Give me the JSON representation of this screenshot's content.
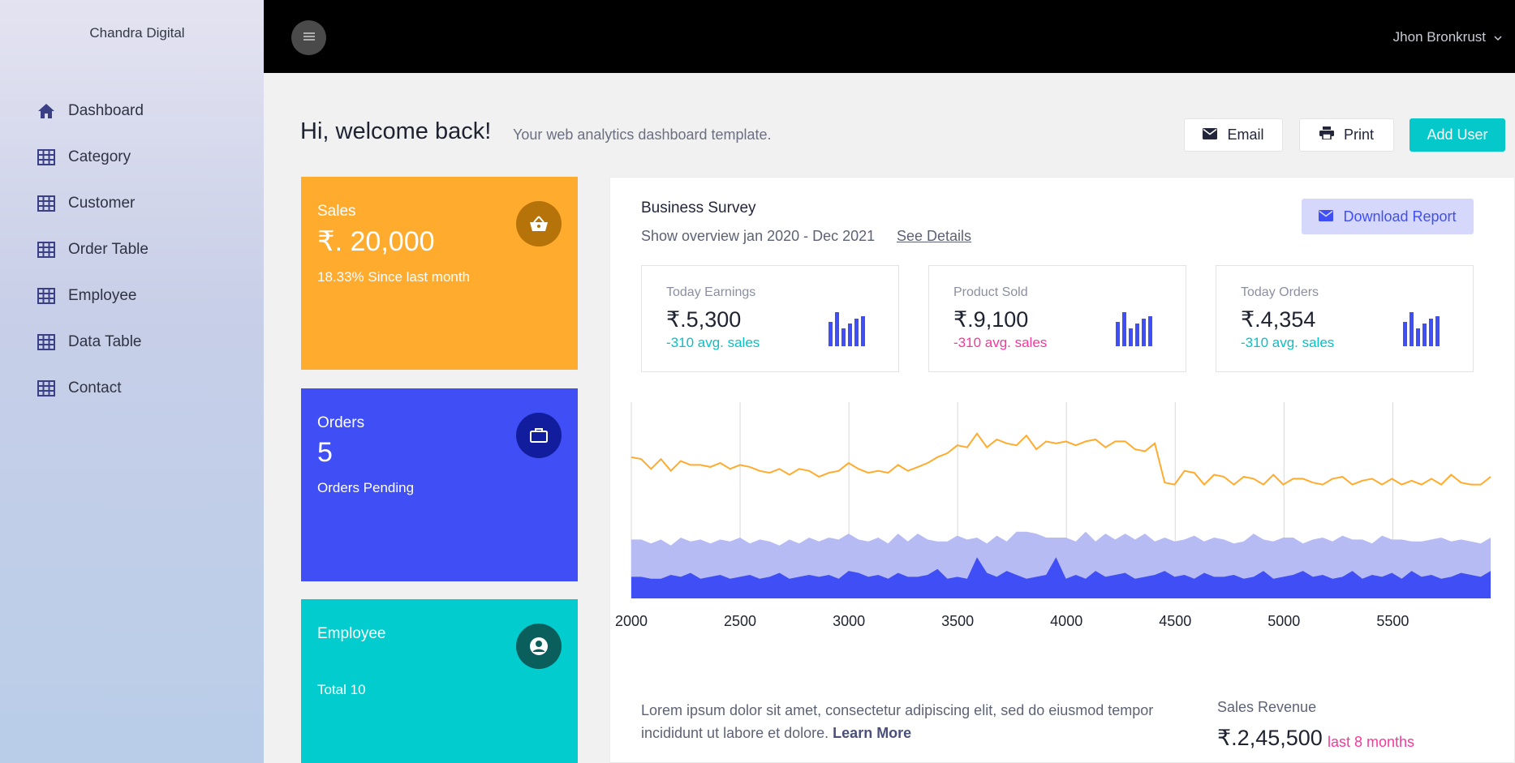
{
  "sidebar": {
    "brand": "Chandra Digital",
    "items": [
      {
        "label": "Dashboard",
        "icon": "home-icon"
      },
      {
        "label": "Category",
        "icon": "grid-icon"
      },
      {
        "label": "Customer",
        "icon": "grid-icon"
      },
      {
        "label": "Order Table",
        "icon": "grid-icon"
      },
      {
        "label": "Employee",
        "icon": "grid-icon"
      },
      {
        "label": "Data Table",
        "icon": "grid-icon"
      },
      {
        "label": "Contact",
        "icon": "grid-icon"
      }
    ]
  },
  "topbar": {
    "menu_icon": "hamburger-icon",
    "user_name": "Jhon Bronkrust"
  },
  "header": {
    "title": "Hi, welcome back!",
    "subtitle": "Your web analytics dashboard template.",
    "email_label": "Email",
    "print_label": "Print",
    "add_user_label": "Add User"
  },
  "cards": [
    {
      "title": "Sales",
      "value": "₹. 20,000",
      "sub": "18.33% Since last month",
      "color": "#ffab2e",
      "icon": "basket-icon"
    },
    {
      "title": "Orders",
      "value": "5",
      "sub": "Orders Pending",
      "color": "#3f4ef5",
      "icon": "briefcase-icon"
    },
    {
      "title": "Employee",
      "value": "",
      "sub": "Total 10",
      "color": "#02ccce",
      "icon": "user-circle-icon"
    }
  ],
  "survey": {
    "title": "Business Survey",
    "subtitle": "Show overview jan 2020 - Dec 2021",
    "link": "See Details",
    "download_label": "Download Report",
    "stats": [
      {
        "label": "Today Earnings",
        "value": "₹.5,300",
        "delta": "-310 avg. sales",
        "delta_color": "#07c1c6"
      },
      {
        "label": "Product Sold",
        "value": "₹.9,100",
        "delta": "-310 avg. sales",
        "delta_color": "#f7379a"
      },
      {
        "label": "Today Orders",
        "value": "₹.4,354",
        "delta": "-310 avg. sales",
        "delta_color": "#07c1c6"
      }
    ],
    "lorem_text": "Lorem ipsum dolor sit amet, consectetur adipiscing elit, sed do eiusmod tempor incididunt ut labore et dolore.",
    "learn_more": "Learn More",
    "revenue_label": "Sales Revenue",
    "revenue_value": "₹.2,45,500",
    "revenue_sub": "last 8 months"
  },
  "chart_data": {
    "type": "line",
    "x_ticks": [
      "2000",
      "2500",
      "3000",
      "3500",
      "4000",
      "4500",
      "5000",
      "5500"
    ],
    "x_range": [
      2000,
      5950
    ],
    "colors": {
      "line": "#ffab2e",
      "area_light": "#b6bbf3",
      "area_dark": "#3f4ef5"
    },
    "series": [
      {
        "type": "line",
        "values": [
          72,
          71,
          66,
          71,
          65,
          70,
          68,
          68,
          67,
          69,
          66,
          68,
          67,
          65,
          64,
          66,
          63,
          66,
          65,
          62,
          64,
          65,
          69,
          66,
          64,
          65,
          64,
          68,
          65,
          67,
          69,
          72,
          74,
          78,
          77,
          84,
          77,
          81,
          79,
          78,
          83,
          76,
          80,
          79,
          80,
          78,
          80,
          81,
          77,
          80,
          80,
          76,
          75,
          79,
          59,
          58,
          65,
          64,
          58,
          63,
          62,
          58,
          62,
          61,
          58,
          63,
          58,
          61,
          61,
          59,
          58,
          61,
          62,
          58,
          60,
          61,
          58,
          61,
          58,
          60,
          58,
          61,
          58,
          63,
          59,
          58,
          58,
          62
        ]
      },
      {
        "type": "area",
        "values": [
          30,
          30,
          28,
          30,
          27,
          31,
          29,
          30,
          28,
          30,
          29,
          31,
          28,
          30,
          29,
          27,
          30,
          28,
          31,
          29,
          31,
          30,
          33,
          30,
          29,
          31,
          28,
          33,
          29,
          33,
          30,
          29,
          29,
          32,
          30,
          31,
          28,
          32,
          29,
          34,
          34,
          33,
          31,
          31,
          31,
          29,
          34,
          29,
          33,
          30,
          33,
          30,
          33,
          29,
          31,
          29,
          30,
          32,
          29,
          31,
          30,
          28,
          29,
          33,
          30,
          29,
          31,
          31,
          28,
          30,
          31,
          29,
          32,
          30,
          30,
          28,
          32,
          30,
          30,
          29,
          29,
          30,
          31,
          29,
          30,
          29,
          28,
          31
        ]
      },
      {
        "type": "area",
        "values": [
          11,
          11,
          10,
          10,
          12,
          11,
          13,
          10,
          11,
          12,
          10,
          11,
          12,
          10,
          11,
          13,
          10,
          11,
          12,
          11,
          12,
          10,
          14,
          13,
          11,
          12,
          10,
          13,
          11,
          11,
          12,
          15,
          10,
          11,
          10,
          21,
          13,
          11,
          14,
          12,
          10,
          11,
          12,
          21,
          10,
          12,
          10,
          14,
          11,
          12,
          13,
          10,
          11,
          12,
          14,
          11,
          12,
          10,
          13,
          11,
          11,
          12,
          10,
          11,
          14,
          10,
          11,
          12,
          14,
          11,
          12,
          10,
          11,
          14,
          10,
          12,
          11,
          13,
          10,
          14,
          11,
          12,
          10,
          11,
          13,
          12,
          11,
          14
        ]
      }
    ]
  }
}
